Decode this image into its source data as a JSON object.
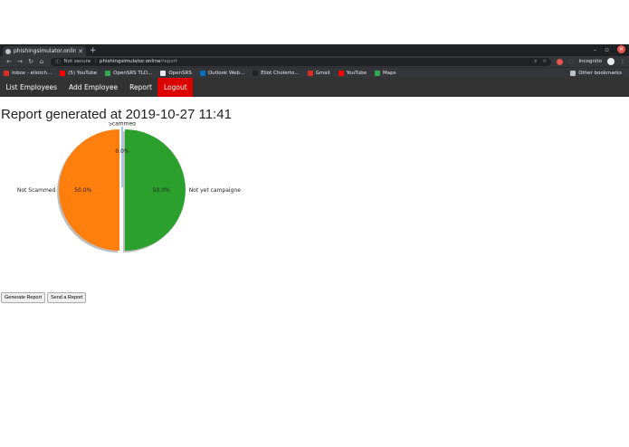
{
  "browser": {
    "tab_title": "phishingsimulator.online/re",
    "address": {
      "security": "Not secure",
      "host": "phishingsimulator.online",
      "path": "/report"
    },
    "incognito_label": "Incognito",
    "bookmarks": [
      {
        "label": "Inbox - eliotch...",
        "color": "#d93025"
      },
      {
        "label": "(5) YouTube",
        "color": "#ff0000"
      },
      {
        "label": "OpenSRS TLD...",
        "color": "#34a853"
      },
      {
        "label": "OpenSRS",
        "color": "#e8eaed"
      },
      {
        "label": "Outlook Web...",
        "color": "#0072c6"
      },
      {
        "label": "Eliot Cholerto...",
        "color": "#222222"
      },
      {
        "label": "Gmail",
        "color": "#d93025"
      },
      {
        "label": "YouTube",
        "color": "#ff0000"
      },
      {
        "label": "Maps",
        "color": "#34a853"
      }
    ],
    "other_bookmarks": "Other bookmarks"
  },
  "nav": {
    "items": [
      {
        "label": "List Employees"
      },
      {
        "label": "Add Employee"
      },
      {
        "label": "Report"
      },
      {
        "label": "Logout"
      }
    ],
    "active_color": "#dd0000"
  },
  "page": {
    "title": "Report generated at 2019-10-27 11:41"
  },
  "chart_data": {
    "type": "pie",
    "slices": [
      {
        "label": "Not Scammed",
        "value": 50.0,
        "pct_label": "50.0%",
        "color": "#ff7f0e"
      },
      {
        "label": "Not yet campaigne",
        "value": 50.0,
        "pct_label": "50.0%",
        "color": "#2ca02c"
      },
      {
        "label": "Scammed",
        "value": 0.0,
        "pct_label": "0.0%",
        "color": "#1f77b4"
      }
    ],
    "shadow": true,
    "exploded": true
  },
  "actions": {
    "generate_label": "Generate Report",
    "send_label": "Send a Report"
  }
}
